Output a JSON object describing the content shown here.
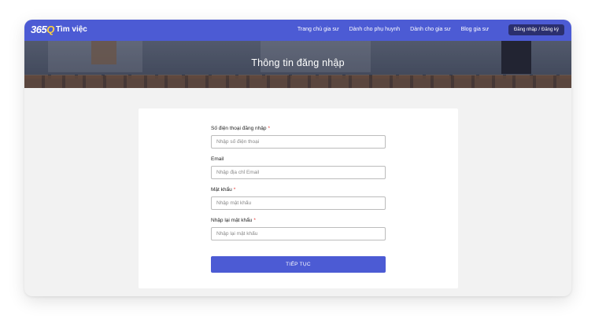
{
  "header": {
    "logo_mark_main": "365",
    "logo_mark_accent": "Q",
    "logo_text": "Tìm việc",
    "nav": [
      {
        "label": "Trang chủ gia sư"
      },
      {
        "label": "Dành cho phụ huynh"
      },
      {
        "label": "Dành cho gia sư"
      },
      {
        "label": "Blog gia sư"
      }
    ],
    "auth": {
      "login": "Đăng nhập",
      "separator": "/",
      "register": "Đăng ký"
    }
  },
  "hero": {
    "title": "Thông tin đăng nhập"
  },
  "form": {
    "phone": {
      "label": "Số điện thoại đăng nhập",
      "required_mark": "*",
      "placeholder": "Nhập số điện thoại",
      "value": ""
    },
    "email": {
      "label": "Email",
      "placeholder": "Nhập địa chỉ Email",
      "value": ""
    },
    "password": {
      "label": "Mật khẩu",
      "required_mark": "*",
      "placeholder": "Nhập mật khẩu",
      "value": ""
    },
    "confirm": {
      "label": "Nhập lại mật khẩu",
      "required_mark": "*",
      "placeholder": "Nhập lại mật khẩu",
      "value": ""
    },
    "submit_label": "TIẾP TỤC"
  },
  "colors": {
    "brand": "#4c5bd4",
    "auth_button": "#2b2f6e",
    "required": "#e53935",
    "page_bg": "#f2f2f2"
  }
}
